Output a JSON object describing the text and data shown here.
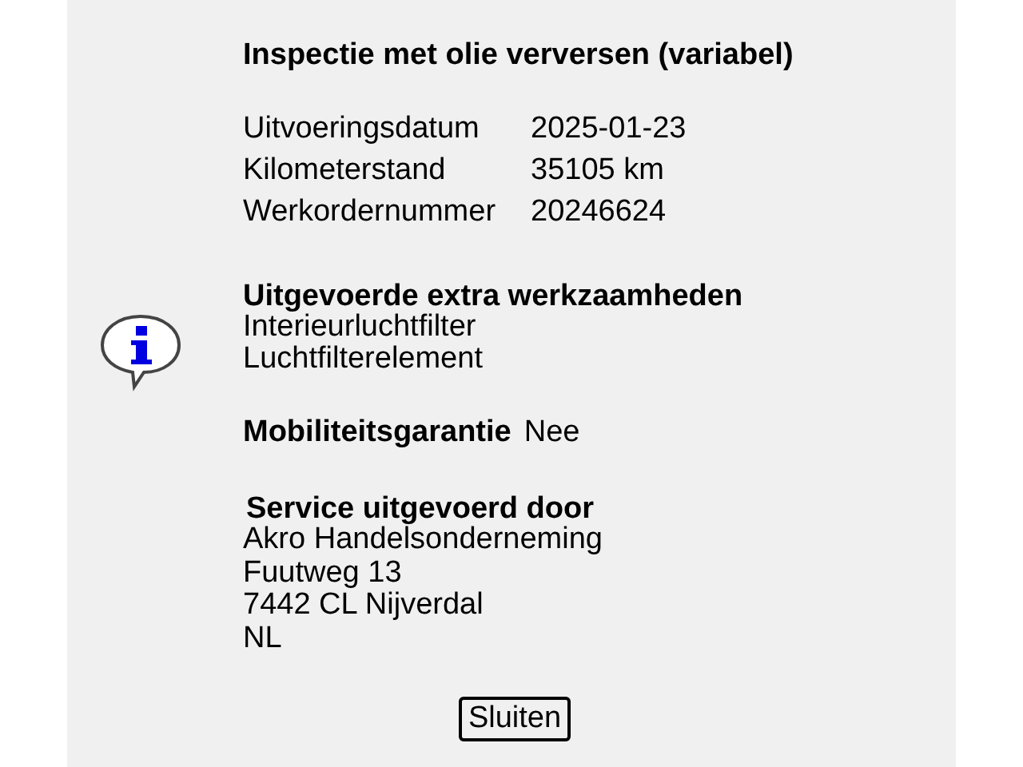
{
  "title": "Inspectie met olie verversen (variabel)",
  "details": [
    {
      "label": "Uitvoeringsdatum",
      "value": "2025-01-23"
    },
    {
      "label": "Kilometerstand",
      "value": "35105 km"
    },
    {
      "label": "Werkordernummer",
      "value": "20246624"
    }
  ],
  "extra_work": {
    "heading": "Uitgevoerde extra werkzaamheden",
    "items": [
      "Interieurluchtfilter",
      "Luchtfilterelement"
    ]
  },
  "mobility": {
    "label": "Mobiliteitsgarantie",
    "value": "Nee"
  },
  "service": {
    "heading": "Service uitgevoerd door",
    "lines": [
      "Akro Handelsonderneming",
      "Fuutweg 13",
      "7442 CL Nijverdal",
      "NL"
    ]
  },
  "close_button": "Sluiten"
}
